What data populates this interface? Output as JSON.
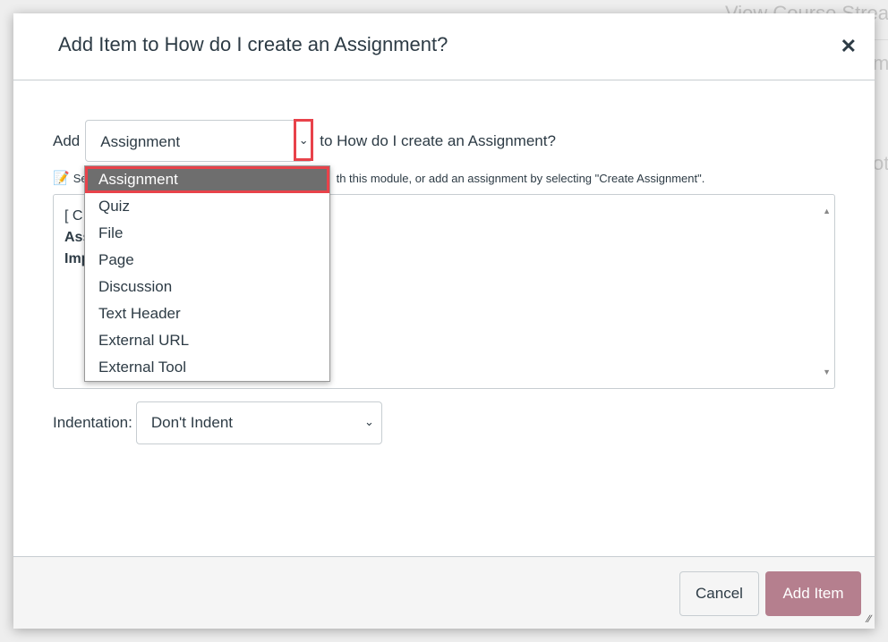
{
  "background": {
    "stream_link": "View Course Strea",
    "frag1": "me",
    "frag2": "oti"
  },
  "dialog": {
    "title": "Add Item to How do I create an Assignment?",
    "close_icon": "close-icon",
    "add_label": "Add",
    "type_select": {
      "value": "Assignment"
    },
    "to_label": "to How do I create an Assignment?",
    "hint_prefix": "Se",
    "hint_text": "th this module, or add an assignment by selecting \"Create Assignment\".",
    "list_fragments": [
      "[ C",
      "Ass",
      "Imp"
    ],
    "dropdown_options": [
      "Assignment",
      "Quiz",
      "File",
      "Page",
      "Discussion",
      "Text Header",
      "External URL",
      "External Tool"
    ],
    "indent_label": "Indentation:",
    "indent_select": {
      "value": "Don't Indent"
    },
    "cancel_label": "Cancel",
    "add_item_label": "Add Item",
    "colors": {
      "primary": "#b57f8e",
      "highlight": "#e8424a"
    }
  }
}
